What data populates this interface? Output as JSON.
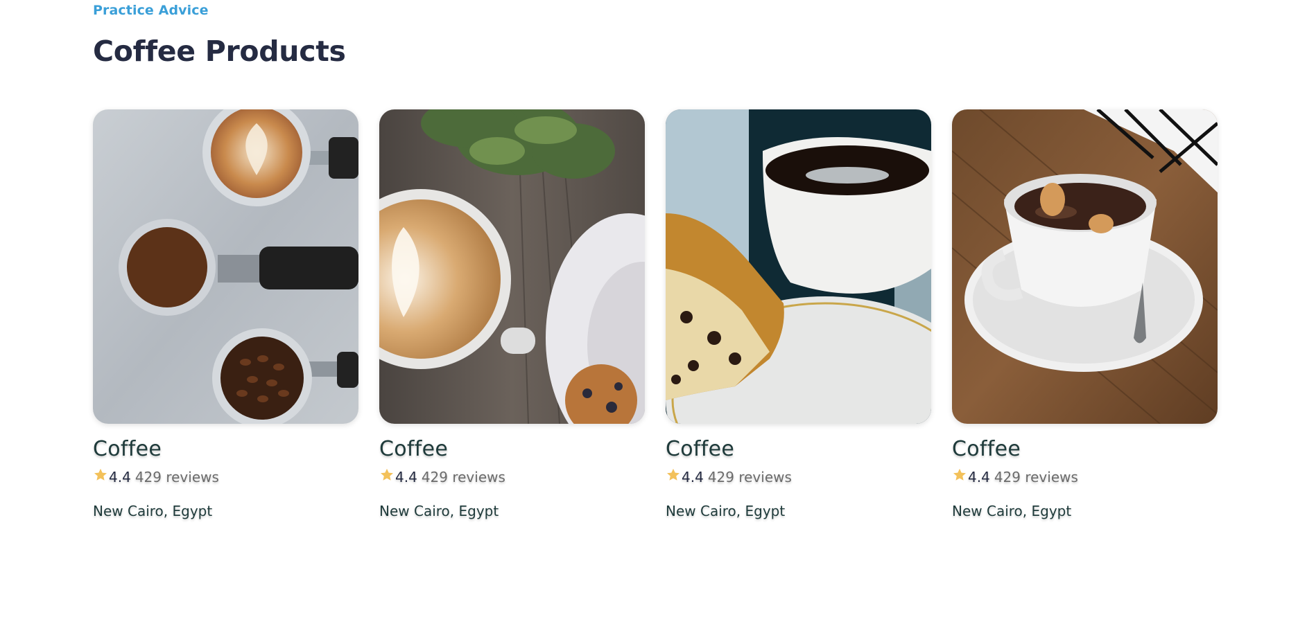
{
  "section": {
    "eyebrow": "Practice Advice",
    "title": "Coffee Products"
  },
  "colors": {
    "eyebrow": "#3a9fd8",
    "title": "#252b42",
    "star": "#f3c15a"
  },
  "products": [
    {
      "image": "espresso-portafilters-photo",
      "name": "Coffee",
      "rating": "4.4",
      "reviews": "429 reviews",
      "location": "New Cairo, Egypt"
    },
    {
      "image": "latte-art-with-cookie-photo",
      "name": "Coffee",
      "rating": "4.4",
      "reviews": "429 reviews",
      "location": "New Cairo, Egypt"
    },
    {
      "image": "black-coffee-with-cake-photo",
      "name": "Coffee",
      "rating": "4.4",
      "reviews": "429 reviews",
      "location": "New Cairo, Egypt"
    },
    {
      "image": "mocha-cup-on-wood-table-photo",
      "name": "Coffee",
      "rating": "4.4",
      "reviews": "429 reviews",
      "location": "New Cairo, Egypt"
    }
  ]
}
